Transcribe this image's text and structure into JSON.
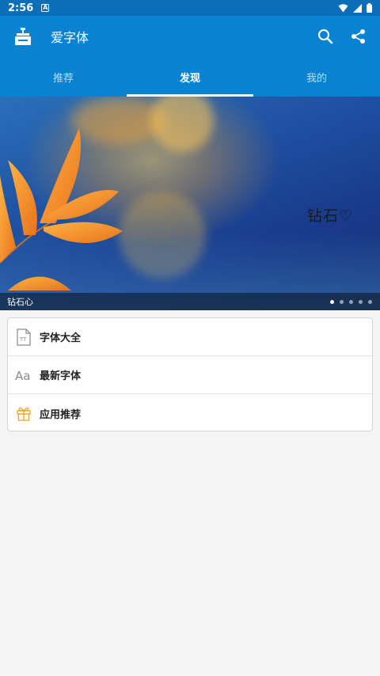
{
  "status_bar": {
    "time": "2:56",
    "notification_glyph": "A"
  },
  "app_bar": {
    "title": "爱字体",
    "icons": [
      "app-logo-icon",
      "search-icon",
      "share-icon"
    ]
  },
  "tabs": [
    {
      "label": "推荐",
      "active": false
    },
    {
      "label": "发现",
      "active": true
    },
    {
      "label": "我的",
      "active": false
    }
  ],
  "banner": {
    "overlay_text": "钻石♡",
    "caption": "钻石心",
    "total_slides": 5,
    "active_slide": 1
  },
  "menu": [
    {
      "label": "字体大全",
      "icon": "font-file-icon"
    },
    {
      "label": "最新字体",
      "icon": "font-aa-icon"
    },
    {
      "label": "应用推荐",
      "icon": "gift-icon"
    }
  ],
  "colors": {
    "primary": "#0a82d2",
    "status_bar": "#0a6fb6",
    "background": "#f5f5f5",
    "gift_accent": "#f0a030"
  }
}
